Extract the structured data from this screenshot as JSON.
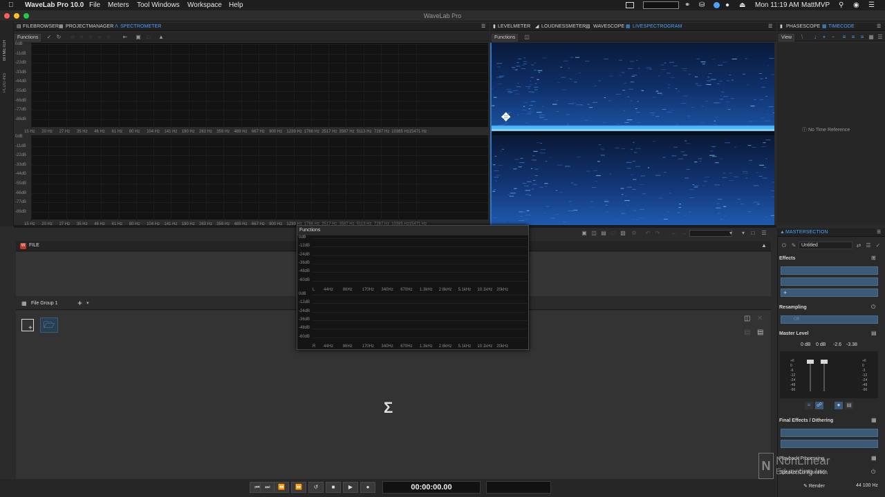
{
  "menubar": {
    "app_name": "WaveLab Pro 10.0",
    "items": [
      "File",
      "Meters",
      "Tool Windows",
      "Workspace",
      "Help"
    ],
    "clock": "Mon 11:19 AM",
    "user": "MattMVP"
  },
  "window": {
    "title": "WaveLab Pro"
  },
  "side_tabs": [
    "BITMETER",
    "PLUG-INS"
  ],
  "left_panel": {
    "tabs": [
      "FILEBROWSER",
      "PROJECTMANAGER",
      "SPECTROMETER"
    ],
    "functions_label": "Functions",
    "db_labels": [
      "0dB",
      "-11dB",
      "-22dB",
      "-33dB",
      "-44dB",
      "-55dB",
      "-66dB",
      "-77dB",
      "-88dB"
    ],
    "freq_labels": [
      "15 Hz",
      "20 Hz",
      "27 Hz",
      "35 Hz",
      "46 Hz",
      "61 Hz",
      "80 Hz",
      "104 Hz",
      "141 Hz",
      "190 Hz",
      "263 Hz",
      "359 Hz",
      "489 Hz",
      "667 Hz",
      "900 Hz",
      "1239 Hz",
      "1766 Hz",
      "2517 Hz",
      "3587 Hz",
      "5113 Hz",
      "7287 Hz",
      "10385 Hz",
      "15471 Hz"
    ]
  },
  "mid_panel": {
    "tabs": [
      "LEVELMETER",
      "LOUDNESSMETER",
      "WAVESCOPE",
      "LIVESPECTROGRAM"
    ],
    "functions_label": "Functions"
  },
  "right_panel": {
    "tabs": [
      "PHASESCOPE",
      "TIMECODE"
    ],
    "view_label": "View",
    "no_time_ref": "No Time Reference"
  },
  "floating_analyzer": {
    "functions_label": "Functions",
    "db_labels": [
      "0dB",
      "-12dB",
      "-24dB",
      "-36dB",
      "-48dB",
      "-60dB"
    ],
    "freq_labels": [
      "44Hz",
      "86Hz",
      "170Hz",
      "340Hz",
      "670Hz",
      "1.3kHz",
      "2.6kHz",
      "5.1kHz",
      "10.1kHz",
      "20kHz"
    ],
    "channel_left": "L",
    "channel_right": "R"
  },
  "file_area": {
    "file_tab": "FILE",
    "file_group": "File Group 1"
  },
  "master_section": {
    "title": "MASTERSECTION",
    "preset": "Untitled",
    "effects_label": "Effects",
    "resampling_label": "Resampling",
    "resampling_value": "Off",
    "master_level_label": "Master Level",
    "level_values": [
      "0 dB",
      "0 dB",
      "-2.6",
      "-3.38"
    ],
    "scale_left": [
      "+6",
      "0",
      "-6",
      "-12",
      "-24",
      "-48",
      "-96"
    ],
    "scale_right": [
      "+6",
      "0",
      "-3",
      "-12",
      "-24",
      "-48",
      "-96"
    ],
    "final_effects_label": "Final Effects / Dithering",
    "playback_label": "Playback Processing",
    "speaker_label": "Speaker Configuration",
    "render_label": "Render",
    "sample_rate": "44 100 Hz"
  },
  "transport": {
    "time": "00:00:00.00"
  },
  "watermark": {
    "line1": "NonLinear",
    "line2": "Educating Inc."
  },
  "colors": {
    "accent": "#4aa3ff",
    "spectrogram": "#1f6fd6"
  }
}
